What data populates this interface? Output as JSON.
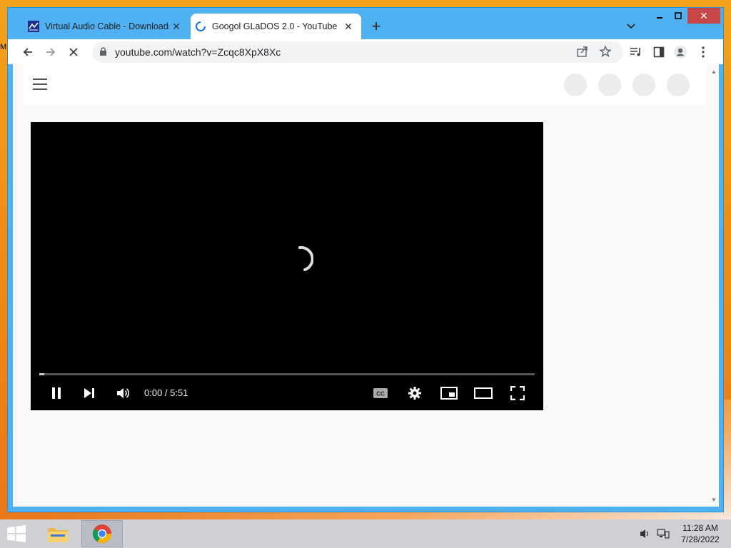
{
  "desktop": {
    "edge_label": "M"
  },
  "browser": {
    "tabs": [
      {
        "title": "Virtual Audio Cable - Downloads",
        "favicon": "vac-icon",
        "active": false
      },
      {
        "title": "Googol GLaDOS 2.0 - YouTube",
        "favicon": "loading-spinner-icon",
        "active": true
      }
    ],
    "new_tab_symbol": "+",
    "toolbar": {
      "url": "youtube.com/watch?v=Zcqc8XpX8Xc",
      "icons": [
        "back-icon",
        "forward-icon",
        "stop-loading-icon",
        "lock-icon",
        "share-icon",
        "star-icon",
        "media-control-icon",
        "side-panel-icon",
        "profile-icon",
        "menu-icon"
      ]
    }
  },
  "player": {
    "time_display": "0:00 / 5:51",
    "progress_fraction": 0.01,
    "controls": [
      "pause-icon",
      "next-icon",
      "volume-icon",
      "captions-icon",
      "settings-icon",
      "miniplayer-icon",
      "theater-mode-icon",
      "fullscreen-icon"
    ]
  },
  "taskbar": {
    "items": [
      "file-explorer-icon",
      "chrome-icon"
    ],
    "clock": {
      "time": "11:28 AM",
      "date": "7/28/2022"
    }
  },
  "colors": {
    "window_frame": "#4fb1f2",
    "close_button": "#c74747",
    "desktop": "#f2a21d",
    "player_bg": "#000000"
  }
}
